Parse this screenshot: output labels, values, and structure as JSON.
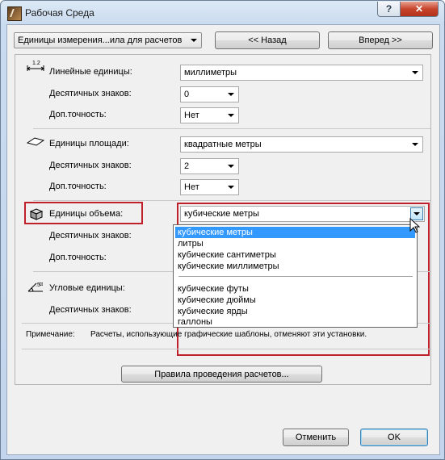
{
  "window": {
    "title": "Рабочая Среда",
    "help_label": "?",
    "close_label": "✕"
  },
  "nav": {
    "selector_value": "Единицы измерения...ила для расчетов",
    "back_label": "<< Назад",
    "forward_label": "Вперед >>"
  },
  "linear": {
    "label": "Линейные единицы:",
    "unit_value": "миллиметры",
    "decimals_label": "Десятичных знаков:",
    "decimals_value": "0",
    "precision_label": "Доп.точность:",
    "precision_value": "Нет"
  },
  "area": {
    "label": "Единицы площади:",
    "unit_value": "квадратные метры",
    "decimals_label": "Десятичных знаков:",
    "decimals_value": "2",
    "precision_label": "Доп.точность:",
    "precision_value": "Нет"
  },
  "volume": {
    "label": "Единицы объема:",
    "unit_value": "кубические метры",
    "decimals_label": "Десятичных знаков:",
    "precision_label": "Доп.точность:",
    "options_group1": [
      "кубические метры",
      "литры",
      "кубические сантиметры",
      "кубические миллиметры"
    ],
    "options_group2": [
      "кубические футы",
      "кубические дюймы",
      "кубические ярды",
      "галлоны"
    ],
    "selected_option": "кубические метры"
  },
  "angle": {
    "label": "Угловые единицы:",
    "decimals_label": "Десятичных знаков:"
  },
  "note": {
    "label": "Примечание:",
    "text": "Расчеты, использующие графические шаблоны, отменяют эти установки."
  },
  "footer": {
    "calc_rules_label": "Правила проведения расчетов...",
    "cancel_label": "Отменить",
    "ok_label": "OK"
  },
  "colors": {
    "highlight_box": "#c0202a",
    "selection": "#3399ff"
  }
}
